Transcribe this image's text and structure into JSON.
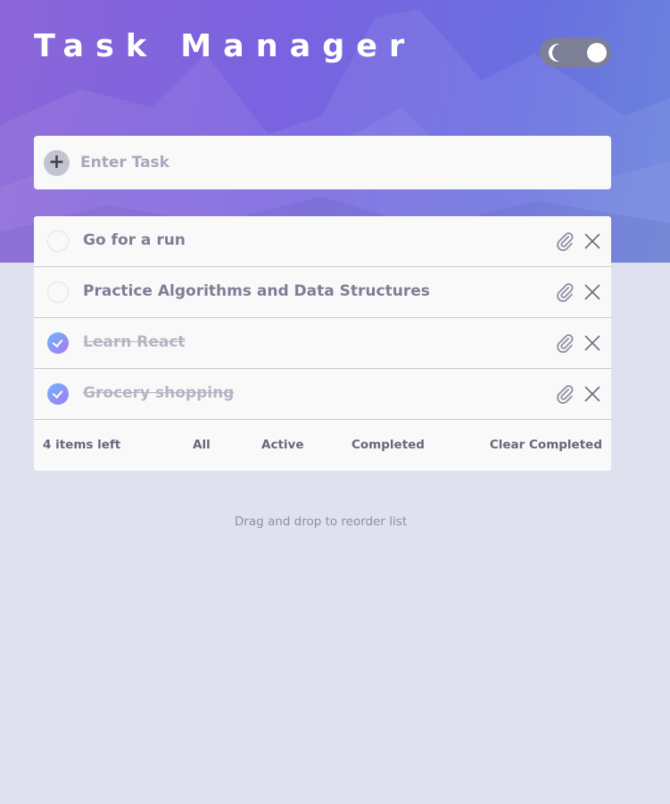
{
  "app": {
    "title": "Task Manager"
  },
  "theme_toggle": {
    "mode": "dark",
    "icon": "moon-icon"
  },
  "entry": {
    "placeholder": "Enter Task",
    "add_icon": "plus-icon"
  },
  "tasks": [
    {
      "text": "Go for a run",
      "completed": false
    },
    {
      "text": "Practice Algorithms and Data Structures",
      "completed": false
    },
    {
      "text": "Learn React",
      "completed": true
    },
    {
      "text": "Grocery shopping",
      "completed": true
    }
  ],
  "footer": {
    "items_left": "4 items left",
    "filter_all": "All",
    "filter_active": "Active",
    "filter_completed": "Completed",
    "clear_completed": "Clear Completed"
  },
  "hint": "Drag and drop to reorder list",
  "colors": {
    "background": "#e0e1ef",
    "card": "#f9f9f9",
    "text": "#7e7f96",
    "completed_text": "#b4b5c3",
    "check_gradient_start": "#6eb6ff",
    "check_gradient_end": "#a978ee",
    "hero_gradient_start": "#8c66d8",
    "hero_gradient_end": "#6a84dc"
  }
}
